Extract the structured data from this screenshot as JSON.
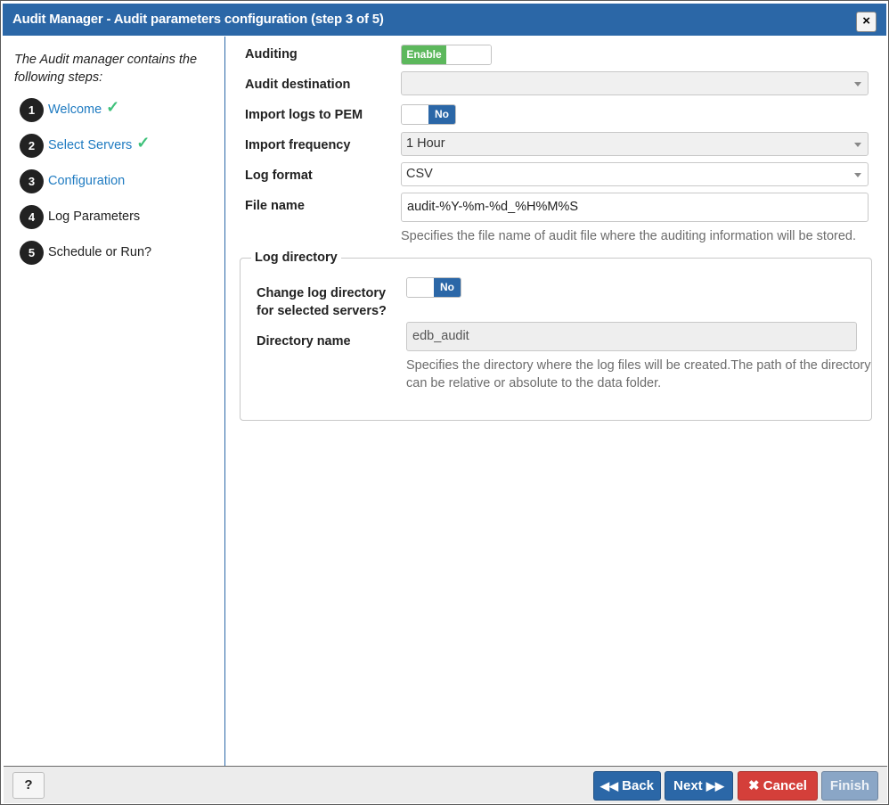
{
  "window": {
    "title": "Audit Manager - Audit parameters configuration (step 3 of 5)",
    "close_label": "×"
  },
  "sidebar": {
    "intro": "The Audit manager contains the following steps:",
    "steps": [
      {
        "number": "1",
        "label": "Welcome",
        "completed": true
      },
      {
        "number": "2",
        "label": "Select Servers",
        "completed": true
      },
      {
        "number": "3",
        "label": "Configuration",
        "completed": false
      },
      {
        "number": "4",
        "label": "Log Parameters",
        "completed": false
      },
      {
        "number": "5",
        "label": "Schedule or Run?",
        "completed": false
      }
    ],
    "check_glyph": "✓"
  },
  "form": {
    "auditing": {
      "label": "Auditing",
      "toggle_text": "Enable"
    },
    "audit_destination": {
      "label": "Audit destination",
      "value": ""
    },
    "import_logs": {
      "label": "Import logs to PEM",
      "toggle_text": "No"
    },
    "import_frequency": {
      "label": "Import frequency",
      "value": "1 Hour"
    },
    "log_format": {
      "label": "Log format",
      "value": "CSV"
    },
    "file_name": {
      "label": "File name",
      "value": "audit-%Y-%m-%d_%H%M%S",
      "help": "Specifies the file name of audit file where the auditing information will be stored."
    }
  },
  "log_directory": {
    "legend": "Log directory",
    "change_label_line1": "Change log directory",
    "change_label_line2": "for selected servers?",
    "change_toggle_text": "No",
    "directory_label": "Directory name",
    "directory_value": "edb_audit",
    "help_line1": "Specifies the directory where the log files will be created.The path of the directory",
    "help_line2": "can be relative or absolute to the data folder."
  },
  "footer": {
    "help_label": "?",
    "back_label": "Back",
    "next_label": "Next",
    "cancel_label": "Cancel",
    "finish_label": "Finish"
  },
  "colors": {
    "titlebar": "#2b67a7",
    "link": "#1f7bc1",
    "check": "#3ec17a",
    "toggle_green": "#5cb85c",
    "cancel_red": "#d43f3a"
  }
}
